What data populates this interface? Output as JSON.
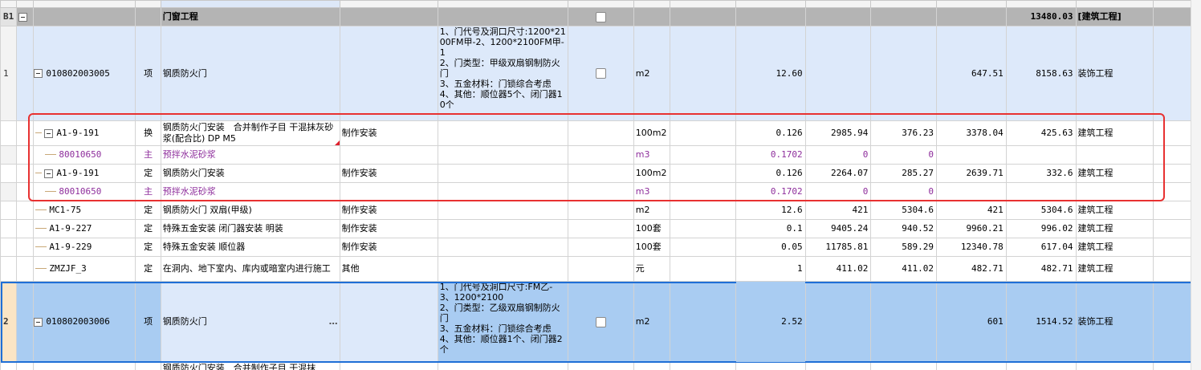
{
  "section": {
    "code": "B1",
    "name": "门窗工程",
    "total": "13480.03",
    "major": "[建筑工程]"
  },
  "rows": [
    {
      "kind": "qd",
      "no": "1",
      "code": "010802003005",
      "type": "项",
      "name": "钢质防火门",
      "feature": "1、门代号及洞口尺寸:1200*2100FM甲-2、1200*2100FM甲-1\n2、门类型：甲级双扇钢制防火门\n3、五金材料：门锁综合考虑\n4、其他：顺位器5个、闭门器10个",
      "unit": "m2",
      "qty": "12.60",
      "comp_price": "647.51",
      "comp_total": "8158.63",
      "major": "装饰工程"
    },
    {
      "kind": "de",
      "code": "A1-9-191",
      "type": "换",
      "name": "钢质防火门安装　合并制作子目 干混抹灰砂浆(配合比) DP M5",
      "work": "制作安装",
      "unit": "100m2",
      "qty": "0.126",
      "price": "2985.94",
      "total": "376.23",
      "comp_price": "3378.04",
      "comp_total": "425.63",
      "major": "建筑工程"
    },
    {
      "kind": "zc",
      "code": "80010650",
      "type": "主",
      "name": "预拌水泥砂浆",
      "unit": "m3",
      "qty": "0.1702",
      "price": "0",
      "total": "0"
    },
    {
      "kind": "de",
      "code": "A1-9-191",
      "type": "定",
      "name": "钢质防火门安装",
      "work": "制作安装",
      "unit": "100m2",
      "qty": "0.126",
      "price": "2264.07",
      "total": "285.27",
      "comp_price": "2639.71",
      "comp_total": "332.6",
      "major": "建筑工程"
    },
    {
      "kind": "zc",
      "code": "80010650",
      "type": "主",
      "name": "预拌水泥砂浆",
      "unit": "m3",
      "qty": "0.1702",
      "price": "0",
      "total": "0"
    },
    {
      "kind": "de2",
      "code": "MC1-75",
      "type": "定",
      "name": "钢质防火门 双扇(甲级)",
      "work": "制作安装",
      "unit": "m2",
      "qty": "12.6",
      "price": "421",
      "total": "5304.6",
      "comp_price": "421",
      "comp_total": "5304.6",
      "major": "建筑工程"
    },
    {
      "kind": "de2",
      "code": "A1-9-227",
      "type": "定",
      "name": "特殊五金安装 闭门器安装 明装",
      "work": "制作安装",
      "unit": "100套",
      "qty": "0.1",
      "price": "9405.24",
      "total": "940.52",
      "comp_price": "9960.21",
      "comp_total": "996.02",
      "major": "建筑工程"
    },
    {
      "kind": "de2",
      "code": "A1-9-229",
      "type": "定",
      "name": "特殊五金安装 顺位器",
      "work": "制作安装",
      "unit": "100套",
      "qty": "0.05",
      "price": "11785.81",
      "total": "589.29",
      "comp_price": "12340.78",
      "comp_total": "617.04",
      "major": "建筑工程"
    },
    {
      "kind": "de2",
      "code": "ZMZJF_3",
      "type": "定",
      "name": "在洞内、地下室内、库内或暗室内进行施工",
      "work": "其他",
      "unit": "元",
      "qty": "1",
      "price": "411.02",
      "total": "411.02",
      "comp_price": "482.71",
      "comp_total": "482.71",
      "major": "建筑工程"
    },
    {
      "kind": "qd2",
      "no": "2",
      "code": "010802003006",
      "type": "项",
      "name": "钢质防火门",
      "ellipsis": "…",
      "feature": "1、门代号及洞口尺寸:FM乙-3、1200*2100\n2、门类型：乙级双扇钢制防火门\n3、五金材料：门锁综合考虑\n4、其他：顺位器1个、闭门器2个",
      "unit": "m2",
      "qty": "2.52",
      "comp_price": "601",
      "comp_total": "1514.52",
      "major": "装饰工程"
    },
    {
      "kind": "cut",
      "name": "钢质防火门安装　合并制作子目 干混抹"
    }
  ]
}
